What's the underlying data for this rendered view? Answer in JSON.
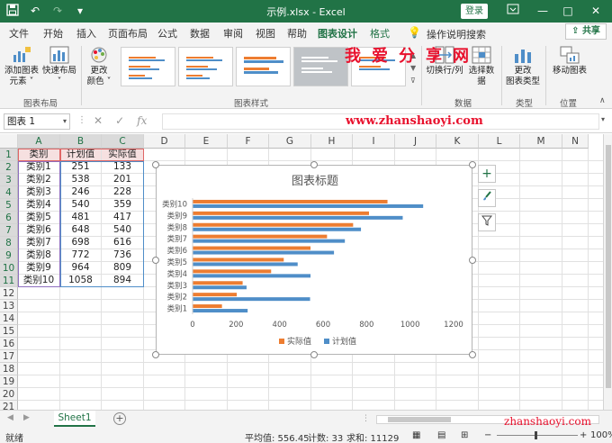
{
  "window": {
    "title": "示例.xlsx  -  Excel",
    "login_label": "登录",
    "controls": [
      "—",
      "□",
      "✕"
    ]
  },
  "quick_access": [
    "save-icon",
    "undo-icon",
    "redo-icon",
    "customize-icon"
  ],
  "tabs": [
    {
      "label": "文件",
      "x": 10
    },
    {
      "label": "开始",
      "x": 48
    },
    {
      "label": "插入",
      "x": 85
    },
    {
      "label": "页面布局",
      "x": 120
    },
    {
      "label": "公式",
      "x": 175
    },
    {
      "label": "数据",
      "x": 211
    },
    {
      "label": "审阅",
      "x": 248
    },
    {
      "label": "视图",
      "x": 284
    },
    {
      "label": "帮助",
      "x": 319
    },
    {
      "label": "图表设计",
      "x": 353,
      "active": true
    },
    {
      "label": "格式",
      "x": 411,
      "accent": true
    }
  ],
  "tell_me": "操作说明搜索",
  "share_label": "共享",
  "ribbon": {
    "add_element": "添加图表\n元素 ˅",
    "quick_layout": "快速布局\n˅",
    "change_colors": "更改\n颜色 ˅",
    "switch_row_col": "切换行/列",
    "select_data": "选择数据",
    "change_type": "更改\n图表类型",
    "move_chart": "移动图表",
    "groups": {
      "layout": "图表布局",
      "styles": "图表样式",
      "data": "数据",
      "type": "类型",
      "location": "位置"
    }
  },
  "watermark": {
    "cn": "我爱分享网",
    "url": "www.zhanshaoyi.com",
    "url2": "zhanshaoyi.com"
  },
  "formula_bar": {
    "name_box": "图表 1",
    "fx": "fx",
    "content": ""
  },
  "grid": {
    "columns": [
      "A",
      "B",
      "C",
      "D",
      "E",
      "F",
      "G",
      "H",
      "I",
      "J",
      "K",
      "L",
      "M",
      "N"
    ],
    "rows": [
      "1",
      "2",
      "3",
      "4",
      "5",
      "6",
      "7",
      "8",
      "9",
      "10",
      "11",
      "12",
      "13",
      "14",
      "15",
      "16",
      "17",
      "18",
      "19",
      "20",
      "21"
    ],
    "headers": [
      "类别",
      "计划值",
      "实际值"
    ],
    "data": [
      [
        "类别1",
        "251",
        "133"
      ],
      [
        "类别2",
        "538",
        "201"
      ],
      [
        "类别3",
        "246",
        "228"
      ],
      [
        "类别4",
        "540",
        "359"
      ],
      [
        "类别5",
        "481",
        "417"
      ],
      [
        "类别6",
        "648",
        "540"
      ],
      [
        "类别7",
        "698",
        "616"
      ],
      [
        "类别8",
        "772",
        "736"
      ],
      [
        "类别9",
        "964",
        "809"
      ],
      [
        "类别10",
        "1058",
        "894"
      ]
    ]
  },
  "chart_data": {
    "type": "bar",
    "orientation": "horizontal",
    "title": "图表标题",
    "categories": [
      "类别1",
      "类别2",
      "类别3",
      "类别4",
      "类别5",
      "类别6",
      "类别7",
      "类别8",
      "类别9",
      "类别10"
    ],
    "series": [
      {
        "name": "计划值",
        "color": "#4f8ec8",
        "values": [
          251,
          538,
          246,
          540,
          481,
          648,
          698,
          772,
          964,
          1058
        ]
      },
      {
        "name": "实际值",
        "color": "#ed7d31",
        "values": [
          133,
          201,
          228,
          359,
          417,
          540,
          616,
          736,
          809,
          894
        ]
      }
    ],
    "xlim": [
      0,
      1200
    ],
    "xticks": [
      "0",
      "200",
      "400",
      "600",
      "800",
      "1000",
      "1200"
    ],
    "legend": "bottom",
    "grid": false
  },
  "sheet": {
    "tab_label": "Sheet1",
    "add_label": "+"
  },
  "status": {
    "ready": "就绪",
    "average": "平均值: 556.45",
    "count": "计数: 33",
    "sum": "求和: 11129",
    "zoom": "100%"
  }
}
